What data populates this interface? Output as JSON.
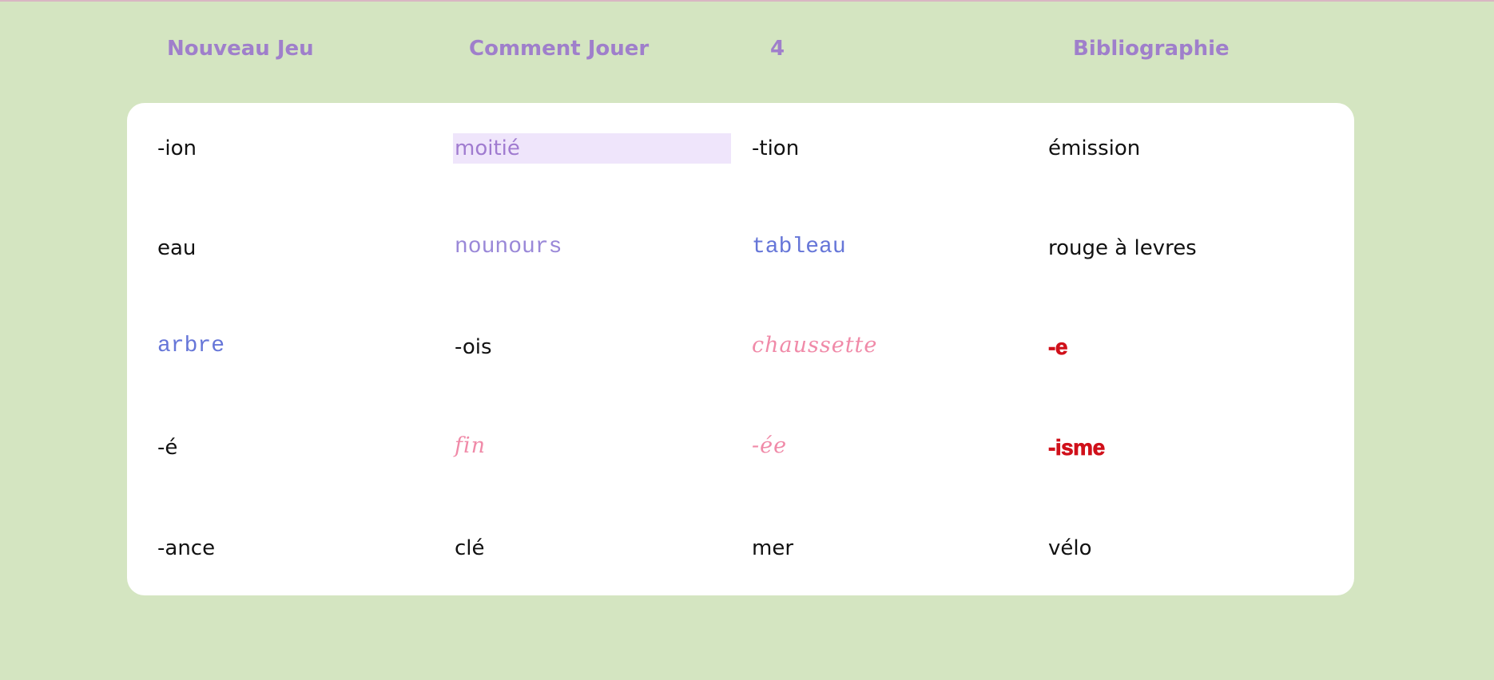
{
  "nav": {
    "new_game": "Nouveau Jeu",
    "how_to_play": "Comment Jouer",
    "counter": "4",
    "bibliography": "Bibliographie"
  },
  "board": {
    "selected_cell": "moitié",
    "style_colors": {
      "plain": "#111111",
      "mono_blue": "#6676d8",
      "mono_purple": "#9a88d8",
      "script_pink": "#f08aa8",
      "heavy_red": "#d0101a",
      "selected_bg": "#efe5fb",
      "selected_text": "#a07bd0"
    },
    "rows": [
      [
        "-ion",
        "moitié",
        "-tion",
        "émission"
      ],
      [
        "eau",
        "nounours",
        "tableau",
        "rouge à levres"
      ],
      [
        "arbre",
        "-ois",
        "chaussette",
        "-e"
      ],
      [
        "-é",
        "fin",
        "-ée",
        "-isme"
      ],
      [
        "-ance",
        "clé",
        "mer",
        "vélo"
      ]
    ]
  }
}
